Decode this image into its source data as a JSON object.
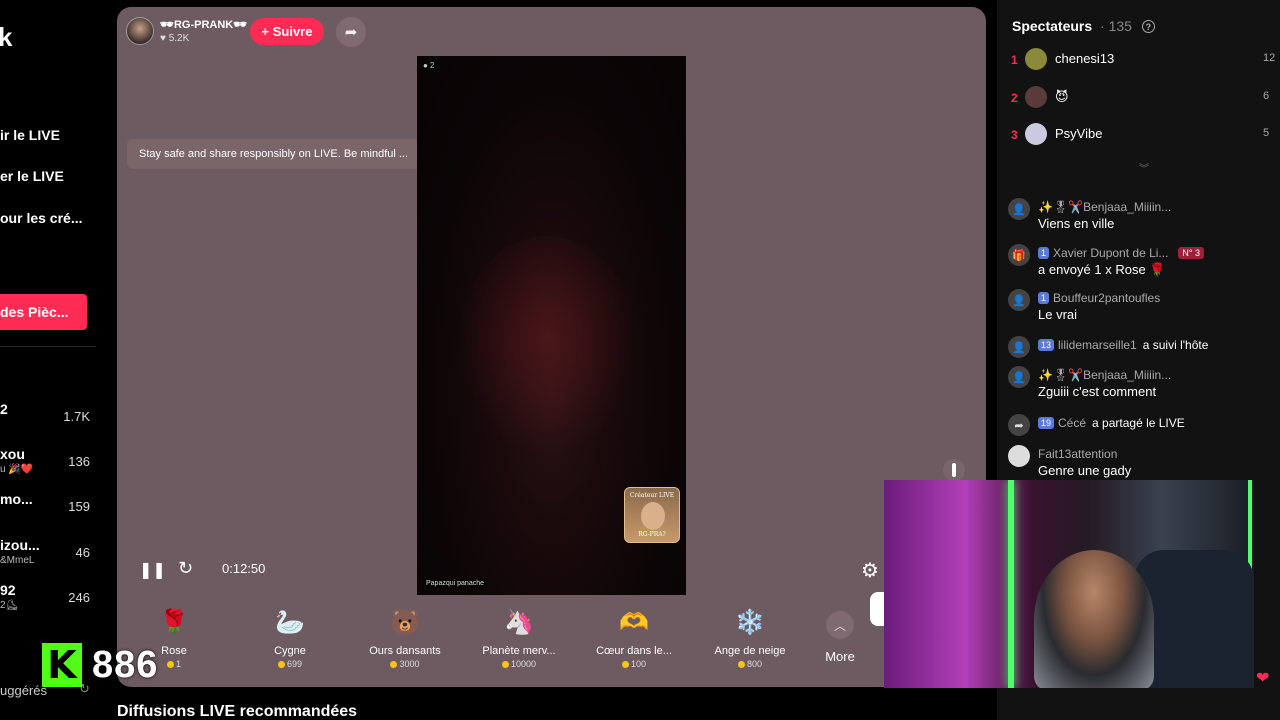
{
  "sidebar": {
    "logo_fragment": "k",
    "links": [
      "ir le LIVE",
      "er le LIVE",
      "our les cré..."
    ],
    "coins_button": "des Pièc...",
    "accounts": [
      {
        "name": "2",
        "sub": "",
        "count": "1.7K"
      },
      {
        "name": "xou",
        "sub": "u 🎉❤️",
        "count": "136"
      },
      {
        "name": "mo...",
        "sub": "",
        "count": "159"
      },
      {
        "name": "izou...",
        "sub": "&MmeL",
        "count": "46"
      },
      {
        "name": "92",
        "sub": "2⛸",
        "count": "246"
      }
    ],
    "suggested": "uggérés"
  },
  "kick": {
    "letter": "K",
    "viewers": "886"
  },
  "stream": {
    "host_name": "🕶RG-PRANK🕶",
    "host_likes": "♥ 5.2K",
    "follow_label": "+ Suivre",
    "notice": "Stay safe and share responsibly on LIVE. Be mindful ...",
    "video_viewers": "● 2",
    "video_caption": "Papazqui panache",
    "creator_badge_top": "Créateur LIVE",
    "creator_badge_bottom": "RG-PRA?",
    "time": "0:12:50"
  },
  "gifts": [
    {
      "name": "Rose",
      "price": "1",
      "icon": "🌹",
      "bg": "transparent"
    },
    {
      "name": "Cygne",
      "price": "699",
      "icon": "🦢",
      "bg": "transparent"
    },
    {
      "name": "Ours dansants",
      "price": "3000",
      "icon": "🐻",
      "bg": "transparent"
    },
    {
      "name": "Planète merv...",
      "price": "10000",
      "icon": "🦄",
      "bg": "transparent"
    },
    {
      "name": "Cœur dans le...",
      "price": "100",
      "icon": "🫶",
      "bg": "transparent"
    },
    {
      "name": "Ange de neige",
      "price": "800",
      "icon": "❄️",
      "bg": "transparent"
    }
  ],
  "more_label": "More",
  "recommend_title": "Diffusions LIVE recommandées",
  "spectators": {
    "title": "Spectateurs",
    "count": "135",
    "top": [
      {
        "rank": "1",
        "name": "chenesi13",
        "score": "12",
        "avatar_color": "#8a8a3a"
      },
      {
        "rank": "2",
        "name": "😈",
        "score": "6",
        "avatar_color": "#5a3a3a"
      },
      {
        "rank": "3",
        "name": "PsyVibe",
        "score": "5",
        "avatar_color": "#c9c9e0"
      }
    ]
  },
  "chat": [
    {
      "user": "✨🎖✂️Benjaaa_Miiiin...",
      "level": "",
      "text": "Viens en ville",
      "action": "",
      "badge": "",
      "avatar": "👤"
    },
    {
      "user": "Xavier Dupont de Li...",
      "level": "1",
      "text": "a envoyé 1 x Rose 🌹",
      "action": "",
      "badge": "N° 3",
      "avatar": "🎁"
    },
    {
      "user": "Bouffeur2pantoufles",
      "level": "1",
      "text": "Le vrai",
      "action": "",
      "badge": "",
      "avatar": "👤"
    },
    {
      "user": "lilidemarseille1",
      "level": "13",
      "text": "",
      "action": "a suivi l'hôte",
      "badge": "",
      "avatar": "👤"
    },
    {
      "user": "✨🎖✂️Benjaaa_Miiiin...",
      "level": "",
      "text": "Zguiii c'est comment",
      "action": "",
      "badge": "",
      "avatar": "👤"
    },
    {
      "user": "Cécé",
      "level": "19",
      "text": "",
      "action": "a partagé le LIVE",
      "badge": "",
      "avatar": "➦"
    },
    {
      "user": "Fait13attention",
      "level": "",
      "text": "Genre une gady",
      "action": "",
      "badge": "",
      "avatar": "●"
    }
  ]
}
